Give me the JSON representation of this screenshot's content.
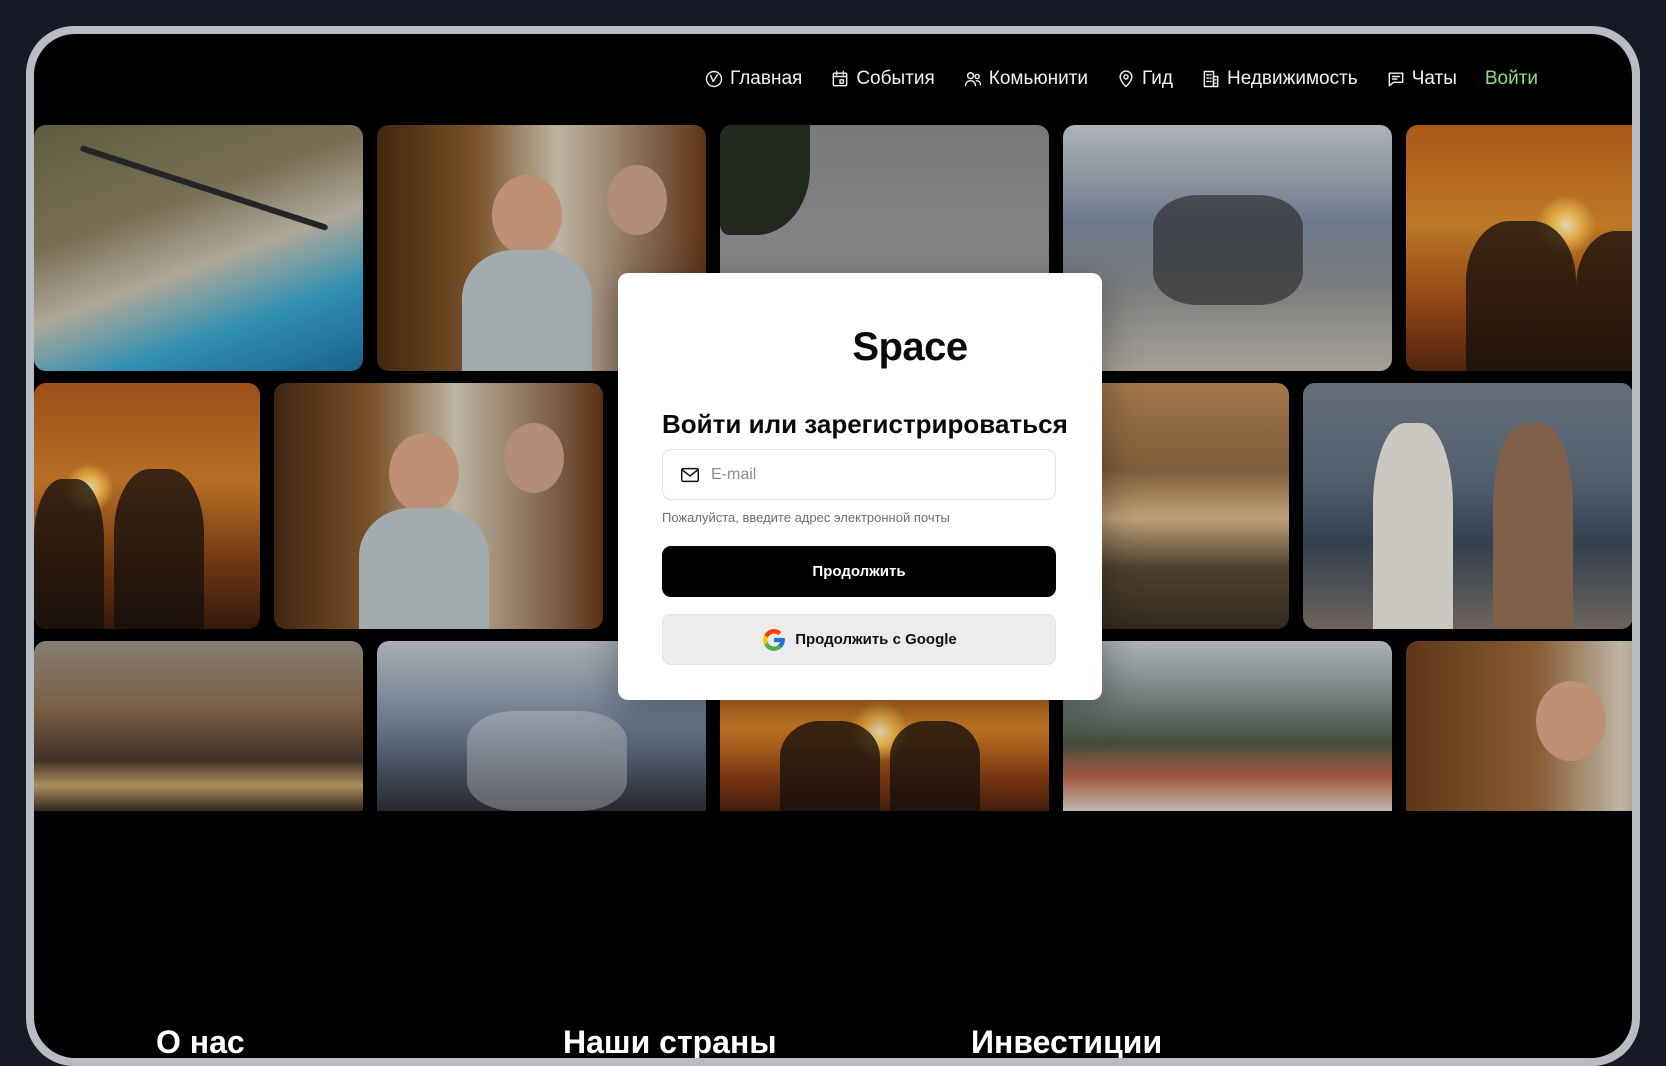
{
  "nav": {
    "items": [
      {
        "label": "Главная",
        "icon": "compass-icon"
      },
      {
        "label": "События",
        "icon": "calendar-icon"
      },
      {
        "label": "Комьюнити",
        "icon": "users-icon"
      },
      {
        "label": "Гид",
        "icon": "map-pin-icon"
      },
      {
        "label": "Недвижимость",
        "icon": "building-icon"
      },
      {
        "label": "Чаты",
        "icon": "chat-icon"
      }
    ],
    "login_label": "Войти",
    "login_color": "#86e07f"
  },
  "modal": {
    "brand": "Space",
    "heading": "Войти или зарегистрироваться",
    "email_placeholder": "E-mail",
    "email_value": "",
    "hint": "Пожалуйста, введите адрес электронной почты",
    "continue_label": "Продолжить",
    "google_label": "Продолжить с Google"
  },
  "sections": [
    {
      "title": "О нас"
    },
    {
      "title": "Наши страны"
    },
    {
      "title": "Инвестиции"
    }
  ],
  "colors": {
    "frame_bg": "#161a26",
    "screen_bg": "#000000",
    "primary_button": "#000000",
    "google_button": "#ececec"
  }
}
